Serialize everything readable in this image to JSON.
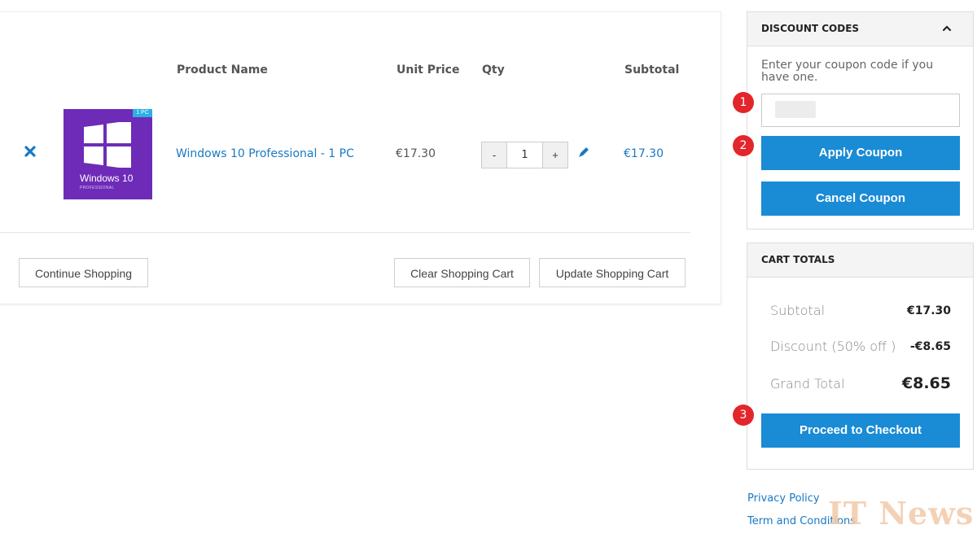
{
  "cart": {
    "headers": {
      "product_name": "Product Name",
      "unit_price": "Unit Price",
      "qty": "Qty",
      "subtotal": "Subtotal"
    },
    "items": [
      {
        "image_title": "Windows 10",
        "image_subtitle": "PROFESSIONAL",
        "image_badge": "1 PC",
        "name": "Windows 10 Professional - 1 PC",
        "unit_price": "€17.30",
        "qty": "1",
        "qty_minus": "-",
        "qty_plus": "+",
        "subtotal": "€17.30"
      }
    ],
    "buttons": {
      "continue": "Continue Shopping",
      "clear": "Clear Shopping Cart",
      "update": "Update Shopping Cart"
    }
  },
  "discount": {
    "title": "DISCOUNT CODES",
    "hint": "Enter your coupon code if you have one.",
    "input_value": "",
    "apply": "Apply Coupon",
    "cancel": "Cancel Coupon"
  },
  "totals": {
    "title": "CART TOTALS",
    "subtotal_label": "Subtotal",
    "subtotal_value": "€17.30",
    "discount_label": "Discount (50% off )",
    "discount_value": "-€8.65",
    "grand_label": "Grand Total",
    "grand_value": "€8.65",
    "checkout": "Proceed to Checkout"
  },
  "markers": [
    "1",
    "2",
    "3"
  ],
  "footer": {
    "privacy": "Privacy Policy",
    "terms": "Term and Conditions"
  },
  "watermark": "IT News",
  "colors": {
    "accent": "#1a8bd5",
    "link": "#1979c3",
    "marker": "#e3262b",
    "product_bg": "#6d2bb7"
  }
}
